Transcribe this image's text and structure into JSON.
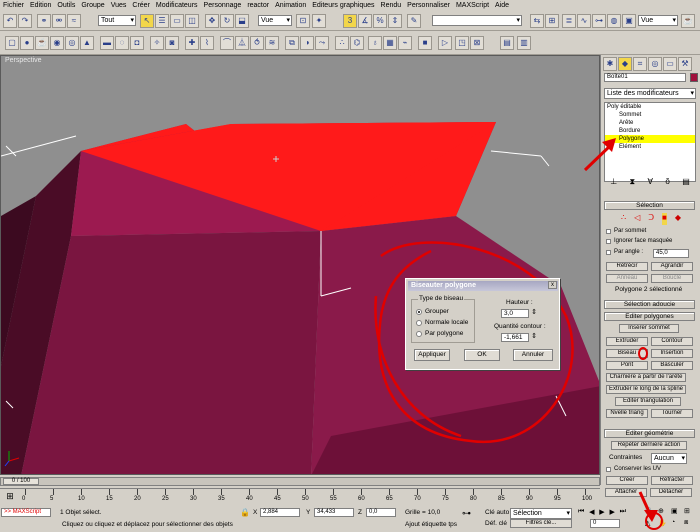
{
  "menu": [
    "Fichier",
    "Edition",
    "Outils",
    "Groupe",
    "Vues",
    "Créer",
    "Modificateurs",
    "Personnage",
    "reactor",
    "Animation",
    "Editeurs graphiques",
    "Rendu",
    "Personnaliser",
    "MAXScript",
    "Aide"
  ],
  "toolbar": {
    "filter_select": "Tout",
    "view_select": "Vue",
    "named_sel_select": "",
    "view_select_right": "Vue"
  },
  "viewport": {
    "label": "Perspective"
  },
  "dialog": {
    "title": "Biseauter polygone",
    "close": "x",
    "bevel_type_label": "Type de biseau",
    "options": [
      "Grouper",
      "Normale locale",
      "Par polygone"
    ],
    "selected_option": "Grouper",
    "height_label": "Hauteur :",
    "height_value": "3,0",
    "outline_label": "Quantité contour :",
    "outline_value": "-1,661",
    "apply": "Appliquer",
    "ok": "OK",
    "cancel": "Annuler"
  },
  "cmdpanel": {
    "object_name": "Boîte01",
    "modifier_list": "Liste des modificateurs",
    "stack": [
      "Poly éditable",
      "Sommet",
      "Arête",
      "Bordure",
      "Polygone",
      "Elément"
    ],
    "selection_header": "Sélection",
    "by_vertex": "Par sommet",
    "ignore_backface": "Ignorer face masquée",
    "by_angle": "Par angle :",
    "angle_value": "45,0",
    "shrink": "Rétrécir",
    "grow": "Agrandir",
    "ring": "Anneau",
    "loop": "Boucle",
    "selection_info": "Polygone 2 sélectionné",
    "soft_selection": "Sélection adoucie",
    "edit_polygons": "Editer polygones",
    "insert_vertex": "Insérer sommet",
    "extrude": "Extruder",
    "outline": "Contour",
    "bevel": "Biseau",
    "inset": "Insertion",
    "bridge": "Pont",
    "flip": "Basculer",
    "hinge": "Charnière à partir de l'arête",
    "extrude_spline": "Extruder le long de la spline",
    "edit_triangulation": "Editer triangulation",
    "retriangulate": "Nvelle triang",
    "turn": "Tourner",
    "edit_geometry": "Editer géométrie",
    "repeat_last": "Répéter dernière action",
    "constraints": "Contraintes",
    "constraints_value": "Aucun",
    "preserve_uv": "Conserver les UV",
    "create": "Créer",
    "collapse": "Réfracter",
    "attach": "Attacher",
    "detach": "Détacher"
  },
  "timeline": {
    "frame": "0 / 100",
    "ticks": [
      "0",
      "5",
      "10",
      "15",
      "20",
      "25",
      "30",
      "35",
      "40",
      "45",
      "50",
      "55",
      "60",
      "65",
      "70",
      "75",
      "80",
      "85",
      "90",
      "95",
      "100"
    ]
  },
  "status": {
    "maxscript": ">> MAXScript",
    "objects_selected": "1 Objet sélect.",
    "prompt": "Cliquez ou cliquez et déplacez pour sélectionner des objets",
    "x_label": "X",
    "x_value": "2,884",
    "y_label": "Y",
    "y_value": "34,433",
    "z_label": "Z",
    "z_value": "0,0",
    "grid": "Grille = 10,0",
    "add_time_tag": "Ajout étiquette tps",
    "auto_key": "Clé auto",
    "set_key": "Déf. clé",
    "selection_select": "Sélection",
    "key_filters": "Filtres clé...",
    "frame_value": "0"
  },
  "colors": {
    "object_top": "#ff1a1a",
    "object_front": "#7a1540",
    "object_side": "#5a0f2e",
    "annotation_red": "#e00000",
    "ui_gray": "#d4d0c8"
  }
}
